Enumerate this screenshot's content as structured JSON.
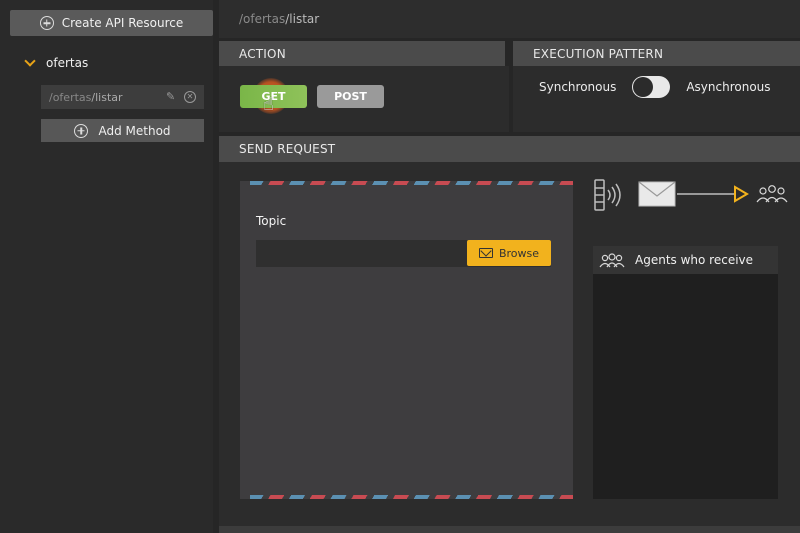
{
  "sidebar": {
    "create_label": "Create API Resource",
    "resource_name": "ofertas",
    "method_path_prefix": "/ofertas",
    "method_path_suffix": "/listar",
    "add_method_label": "Add Method"
  },
  "breadcrumb": {
    "prefix": "/ofertas",
    "suffix": "/listar"
  },
  "action": {
    "header": "ACTION",
    "get_label": "GET",
    "post_label": "POST"
  },
  "execution": {
    "header": "EXECUTION PATTERN",
    "sync_label": "Synchronous",
    "async_label": "Asynchronous"
  },
  "send": {
    "header": "SEND REQUEST",
    "topic_label": "Topic",
    "topic_value": "",
    "browse_label": "Browse",
    "agents_label": "Agents who receive"
  },
  "colors": {
    "accent": "#f2b21d",
    "get_active": "#7ab648",
    "stripe_red": "#c74b52",
    "stripe_blue": "#5b90b2"
  },
  "icons": [
    "circle-plus-icon",
    "chevron-down-icon",
    "pencil-icon",
    "close-circle-icon",
    "hand-cursor-icon",
    "mail-icon",
    "satellite-icon",
    "envelope-icon",
    "arrow-right-icon",
    "agents-icon"
  ]
}
